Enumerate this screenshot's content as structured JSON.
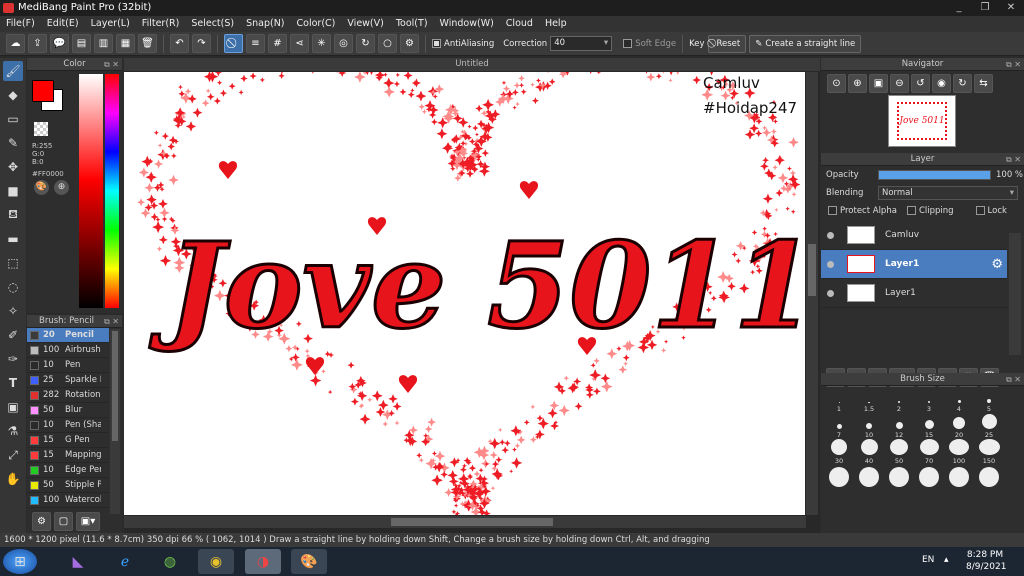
{
  "window": {
    "title": "MediBang Paint Pro (32bit)",
    "minimize": "_",
    "restore": "❐",
    "close": "✕"
  },
  "menu": [
    "File(F)",
    "Edit(E)",
    "Layer(L)",
    "Filter(R)",
    "Select(S)",
    "Snap(N)",
    "Color(C)",
    "View(V)",
    "Tool(T)",
    "Window(W)",
    "Cloud",
    "Help"
  ],
  "toolbar": {
    "antialiasing_label": "AntiAliasing",
    "correction_label": "Correction",
    "correction_value": "40",
    "soft_edge_label": "Soft Edge",
    "key_label": "Key",
    "reset_label": "Reset",
    "straight_line_label": "Create a straight line"
  },
  "color_panel": {
    "title": "Color",
    "r": "R:255",
    "g": "G:0",
    "b": "B:0",
    "hex": "#FF0000",
    "primary_color": "#ff0000",
    "secondary_color": "#ffffff"
  },
  "brush_panel": {
    "title": "Brush: Pencil",
    "items": [
      {
        "size": "20",
        "name": "Pencil",
        "color": "#3b3b3b"
      },
      {
        "size": "100",
        "name": "Airbrush",
        "color": "#bdbdbd"
      },
      {
        "size": "10",
        "name": "Pen",
        "color": "#2a2a2a"
      },
      {
        "size": "25",
        "name": "Sparkle B",
        "color": "#3f5fff"
      },
      {
        "size": "282",
        "name": "Rotation",
        "color": "#e03030"
      },
      {
        "size": "50",
        "name": "Blur",
        "color": "#ff90ff"
      },
      {
        "size": "10",
        "name": "Pen (Sha",
        "color": "#2a2a2a"
      },
      {
        "size": "15",
        "name": "G Pen",
        "color": "#ff3b3b"
      },
      {
        "size": "15",
        "name": "Mapping",
        "color": "#ff3b3b"
      },
      {
        "size": "10",
        "name": "Edge Per",
        "color": "#22cc22"
      },
      {
        "size": "50",
        "name": "Stipple P",
        "color": "#e8e800"
      },
      {
        "size": "100",
        "name": "Watercol",
        "color": "#22bbff"
      }
    ]
  },
  "canvas": {
    "tab_title": "Untitled",
    "watermark_line1": "Camluv",
    "watermark_line2": "#Hoidap247",
    "artwork_text": "Jove 5011"
  },
  "navigator": {
    "title": "Navigator"
  },
  "layer_panel": {
    "title": "Layer",
    "opacity_label": "Opacity",
    "opacity_value": "100 %",
    "opacity_fraction": 1.0,
    "blending_label": "Blending",
    "blending_value": "Normal",
    "protect_alpha": "Protect Alpha",
    "clipping": "Clipping",
    "lock": "Lock",
    "layers": [
      {
        "name": "Camluv",
        "selected": false
      },
      {
        "name": "Layer1",
        "selected": true
      },
      {
        "name": "Layer1",
        "selected": false
      }
    ]
  },
  "brush_size_panel": {
    "title": "Brush Size",
    "sizes": [
      "1",
      "1.5",
      "2",
      "3",
      "4",
      "5",
      "7",
      "10",
      "12",
      "15",
      "20",
      "25",
      "30",
      "40",
      "50",
      "70",
      "100",
      "150"
    ]
  },
  "status": {
    "text": "1600 * 1200 pixel   (11.6 * 8.7cm)   350 dpi   66 %   ( 1062, 1014 )   Draw a straight line by holding down Shift, Change a brush size by holding down Ctrl, Alt, and dragging"
  },
  "taskbar": {
    "lang": "EN",
    "time": "8:28 PM",
    "date": "8/9/2021"
  }
}
